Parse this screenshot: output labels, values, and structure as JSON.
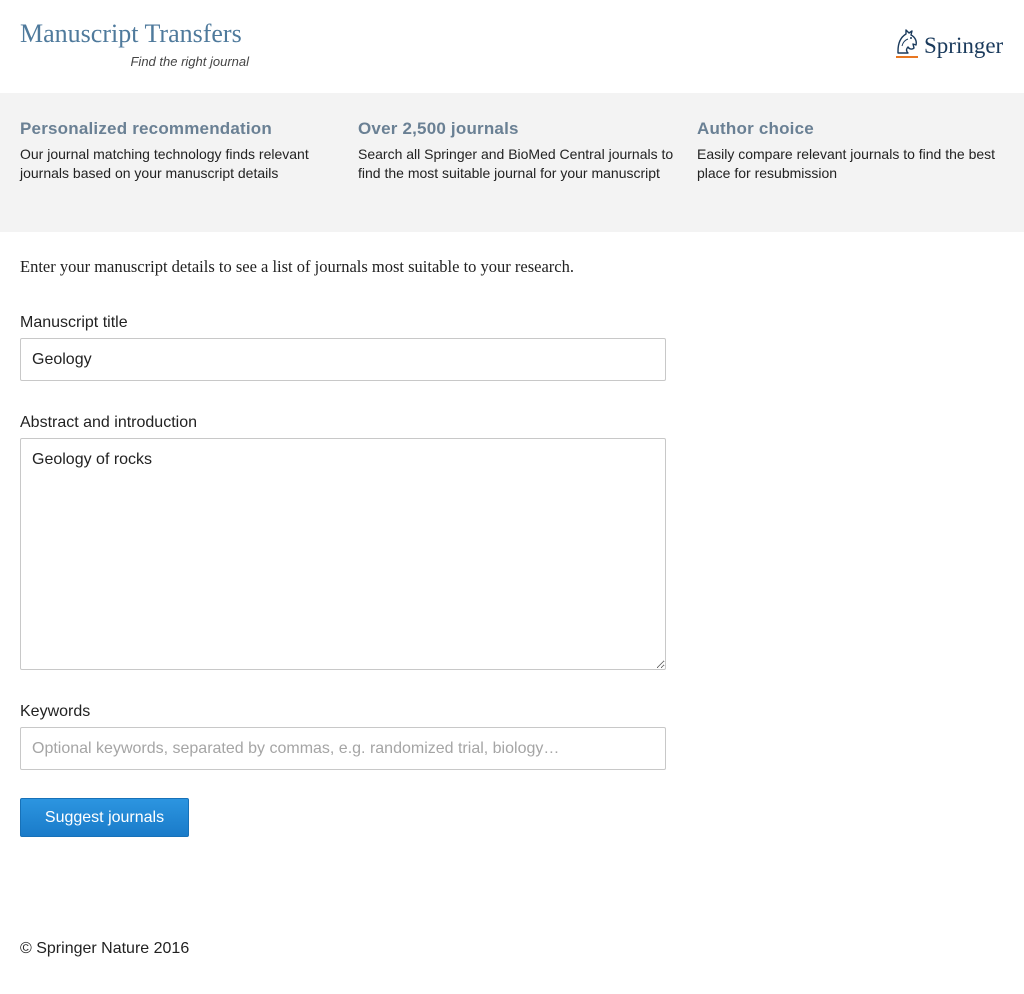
{
  "header": {
    "title": "Manuscript Transfers",
    "tagline": "Find the right journal",
    "logo_text": "Springer",
    "logo_icon": "springer-horse-icon"
  },
  "features": [
    {
      "title": "Personalized recommendation",
      "text": "Our journal matching technology finds relevant journals based on your manuscript details"
    },
    {
      "title": "Over 2,500 journals",
      "text": "Search all Springer and BioMed Central journals to find the most suitable journal for your manuscript"
    },
    {
      "title": "Author choice",
      "text": "Easily compare relevant journals to find the best place for resubmission"
    }
  ],
  "form": {
    "intro": "Enter your manuscript details to see a list of journals most suitable to your research.",
    "title_label": "Manuscript title",
    "title_value": "Geology",
    "abstract_label": "Abstract and introduction",
    "abstract_value": "Geology of rocks",
    "keywords_label": "Keywords",
    "keywords_value": "",
    "keywords_placeholder": "Optional keywords, separated by commas, e.g. randomized trial, biology…",
    "submit_label": "Suggest journals"
  },
  "footer": {
    "copyright": "© Springer Nature 2016"
  },
  "colors": {
    "brand_title": "#4f7a9c",
    "feature_title": "#6a8094",
    "button": "#1a7bc9",
    "band_background": "#f3f3f3",
    "logo_accent": "#e87722"
  }
}
